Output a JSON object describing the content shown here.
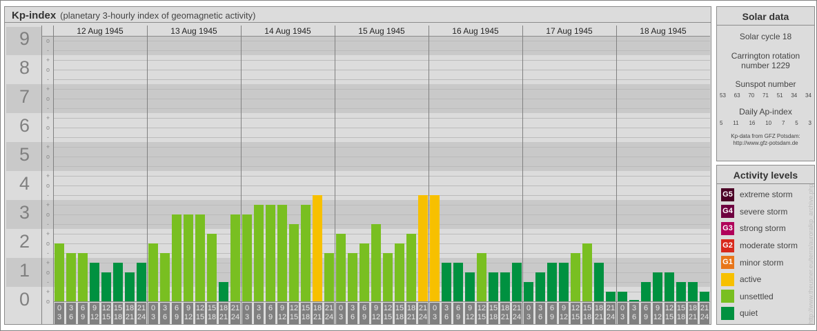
{
  "title": {
    "main": "Kp-index",
    "sub": "(planetary 3-hourly index of geomagnetic activity)"
  },
  "chart_data": {
    "type": "bar",
    "title": "Kp-index",
    "ylabel": "Kp",
    "ylim": [
      0,
      9
    ],
    "y_ticks": [
      "0",
      "1",
      "2",
      "3",
      "4",
      "5",
      "6",
      "7",
      "8",
      "9"
    ],
    "sub_ticks": [
      "-",
      "o",
      "+"
    ],
    "days": [
      "12 Aug 1945",
      "13 Aug 1945",
      "14 Aug 1945",
      "15 Aug 1945",
      "16 Aug 1945",
      "17 Aug 1945",
      "18 Aug 1945"
    ],
    "intervals": [
      [
        "0",
        "3"
      ],
      [
        "3",
        "6"
      ],
      [
        "6",
        "9"
      ],
      [
        "9",
        "12"
      ],
      [
        "12",
        "15"
      ],
      [
        "15",
        "18"
      ],
      [
        "18",
        "21"
      ],
      [
        "21",
        "24"
      ]
    ],
    "values": [
      [
        2.0,
        1.67,
        1.67,
        1.33,
        1.0,
        1.33,
        1.0,
        1.33
      ],
      [
        2.0,
        1.67,
        3.0,
        3.0,
        3.0,
        2.33,
        0.67,
        3.0
      ],
      [
        3.0,
        3.33,
        3.33,
        3.33,
        2.67,
        3.33,
        3.67,
        1.67
      ],
      [
        2.33,
        1.67,
        2.0,
        2.67,
        1.67,
        2.0,
        2.33,
        3.67
      ],
      [
        3.67,
        1.33,
        1.33,
        1.0,
        1.67,
        1.0,
        1.0,
        1.33
      ],
      [
        0.67,
        1.0,
        1.33,
        1.33,
        1.67,
        2.0,
        1.33,
        0.33
      ],
      [
        0.33,
        0.0,
        0.67,
        1.0,
        1.0,
        0.67,
        0.67,
        0.33
      ]
    ],
    "levels": {
      "quiet": "#009140",
      "unsettled": "#79bf21",
      "active": "#f7c000"
    }
  },
  "solar": {
    "title": "Solar data",
    "cycle": "Solar cycle 18",
    "carrington1": "Carrington rotation",
    "carrington2": "number 1229",
    "sunspot_label": "Sunspot number",
    "sunspots": [
      "53",
      "63",
      "70",
      "71",
      "51",
      "34",
      "34"
    ],
    "ap_label": "Daily Ap-index",
    "ap": [
      "5",
      "11",
      "16",
      "10",
      "7",
      "5",
      "3"
    ],
    "source1": "Kp-data from GFZ Potsdam:",
    "source2": "http://www.gfz-potsdam.de"
  },
  "activity": {
    "title": "Activity levels",
    "items": [
      {
        "code": "G5",
        "label": "extreme storm",
        "color": "#4b0026"
      },
      {
        "code": "G4",
        "label": "severe storm",
        "color": "#6e0040"
      },
      {
        "code": "G3",
        "label": "strong storm",
        "color": "#b0005a"
      },
      {
        "code": "G2",
        "label": "moderate storm",
        "color": "#d8291c"
      },
      {
        "code": "G1",
        "label": "minor storm",
        "color": "#e8761a"
      },
      {
        "code": "",
        "label": "active",
        "color": "#f7c000"
      },
      {
        "code": "",
        "label": "unsettled",
        "color": "#79bf21"
      },
      {
        "code": "",
        "label": "quiet",
        "color": "#009140"
      }
    ]
  },
  "watermark": "http://www.theusner.eu/terra/auroralkp_archive.php"
}
